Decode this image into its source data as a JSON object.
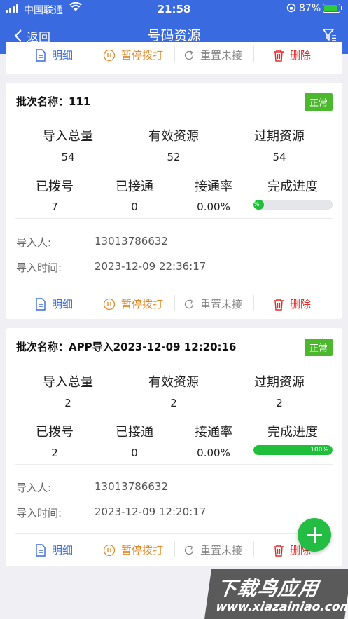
{
  "status_bar": {
    "carrier": "中国联通",
    "time": "21:58",
    "battery_pct": "87%"
  },
  "nav": {
    "back_label": "返回",
    "title": "号码资源"
  },
  "actions": {
    "detail": "明细",
    "pause": "暂停拨打",
    "reset": "重置未接",
    "delete": "删除"
  },
  "labels": {
    "import_total": "导入总量",
    "valid": "有效资源",
    "expired": "过期资源",
    "dialed": "已拨号",
    "connected": "已接通",
    "connect_rate": "接通率",
    "progress": "完成进度",
    "importer": "导入人:",
    "import_time": "导入时间:"
  },
  "batches": [
    {
      "title": "批次名称：111",
      "status": "正常",
      "import_total": "54",
      "valid": "52",
      "expired": "54",
      "dialed": "7",
      "connected": "0",
      "connect_rate": "0.00%",
      "progress_pct": 13,
      "progress_label": "%",
      "importer": "13013786632",
      "import_time": "2023-12-09 22:36:17"
    },
    {
      "title": "批次名称：APP导入2023-12-09 12:20:16",
      "status": "正常",
      "import_total": "2",
      "valid": "2",
      "expired": "2",
      "dialed": "2",
      "connected": "0",
      "connect_rate": "0.00%",
      "progress_pct": 100,
      "progress_label": "100%",
      "importer": "13013786632",
      "import_time": "2023-12-09 12:20:17"
    }
  ],
  "watermark": {
    "text": "下载鸟应用",
    "url": "www.xiazainiao.com"
  }
}
